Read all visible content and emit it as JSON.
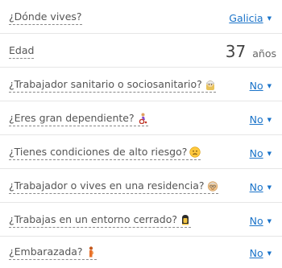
{
  "form": {
    "location": {
      "label": "¿Dónde vives?",
      "value": "Galicia"
    },
    "age": {
      "label": "Edad",
      "value": "37",
      "unit": "años"
    },
    "questions": [
      {
        "label": "¿Trabajador sanitario o sociosanitario?",
        "value": "No",
        "icon": "health-worker-icon"
      },
      {
        "label": "¿Eres gran dependiente?",
        "value": "No",
        "icon": "wheelchair-person-icon"
      },
      {
        "label": "¿Tienes condiciones de alto riesgo?",
        "value": "No",
        "icon": "worried-face-icon"
      },
      {
        "label": "¿Trabajador o vives en una residencia?",
        "value": "No",
        "icon": "elderly-face-icon"
      },
      {
        "label": "¿Trabajas en un entorno cerrado?",
        "value": "No",
        "icon": "closed-space-icon"
      },
      {
        "label": "¿Embarazada?",
        "value": "No",
        "icon": "pregnant-woman-icon"
      }
    ],
    "caret": "▼",
    "colors": {
      "link": "#1a73c9",
      "divider": "#e6e6e6"
    }
  }
}
